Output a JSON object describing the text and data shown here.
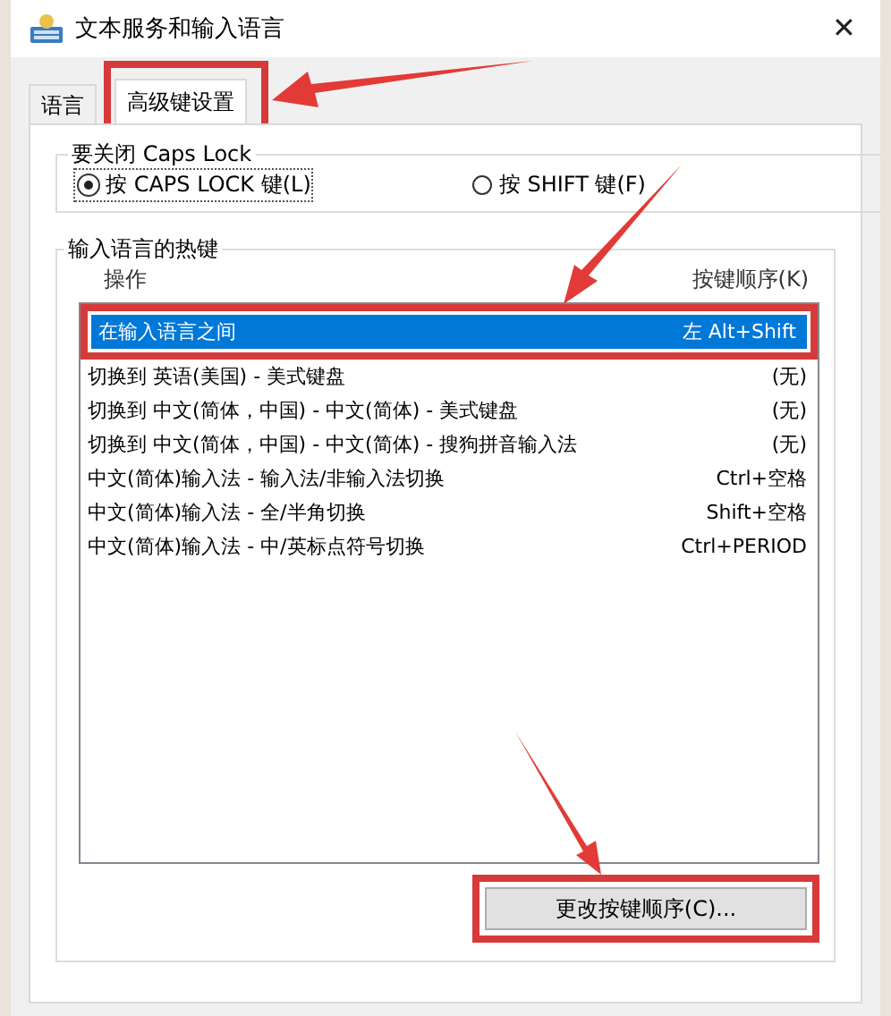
{
  "window": {
    "title": "文本服务和输入语言",
    "close": "✕"
  },
  "tabs": [
    {
      "label": "语言",
      "selected": false
    },
    {
      "label": "高级键设置",
      "selected": true
    }
  ],
  "caps_lock": {
    "title": "要关闭 Caps Lock",
    "options": [
      {
        "label": "按 CAPS LOCK 键(L)",
        "selected": true
      },
      {
        "label": "按 SHIFT 键(F)",
        "selected": false
      }
    ]
  },
  "hotkeys": {
    "title": "输入语言的热键",
    "columns": [
      "操作",
      "按键顺序(K)"
    ],
    "rows": [
      {
        "action": "在输入语言之间",
        "keys": "左 Alt+Shift",
        "selected": true
      },
      {
        "action": "切换到 英语(美国) - 美式键盘",
        "keys": "(无)",
        "selected": false
      },
      {
        "action": "切换到 中文(简体，中国) - 中文(简体) - 美式键盘",
        "keys": "(无)",
        "selected": false
      },
      {
        "action": "切换到 中文(简体，中国) - 中文(简体) - 搜狗拼音输入法",
        "keys": "(无)",
        "selected": false
      },
      {
        "action": "中文(简体)输入法 - 输入法/非输入法切换",
        "keys": "Ctrl+空格",
        "selected": false
      },
      {
        "action": "中文(简体)输入法 - 全/半角切换",
        "keys": "Shift+空格",
        "selected": false
      },
      {
        "action": "中文(简体)输入法 - 中/英标点符号切换",
        "keys": "Ctrl+PERIOD",
        "selected": false
      }
    ]
  },
  "button": "更改按键顺序(C)..."
}
